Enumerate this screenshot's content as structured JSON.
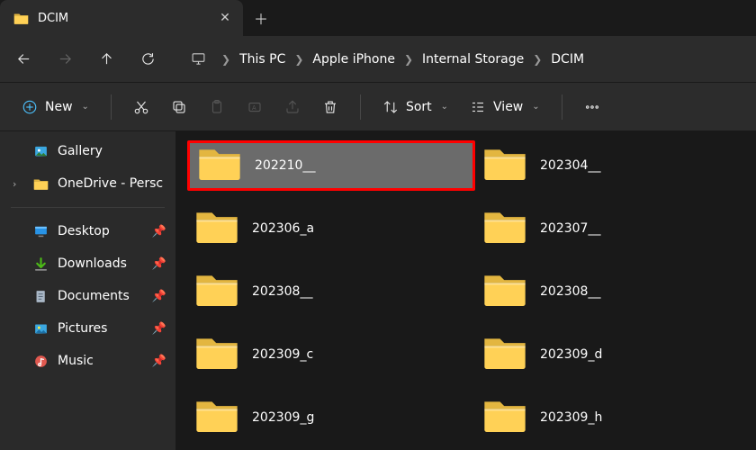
{
  "tab": {
    "title": "DCIM"
  },
  "breadcrumbs": {
    "items": [
      "This PC",
      "Apple iPhone",
      "Internal Storage",
      "DCIM"
    ]
  },
  "toolbar": {
    "new_label": "New",
    "sort_label": "Sort",
    "view_label": "View"
  },
  "sidebar": {
    "gallery": "Gallery",
    "onedrive": "OneDrive - Persc",
    "desktop": "Desktop",
    "downloads": "Downloads",
    "documents": "Documents",
    "pictures": "Pictures",
    "music": "Music"
  },
  "folders": [
    {
      "name": "202210__",
      "selected": true
    },
    {
      "name": "202304__"
    },
    {
      "name": "202306_a"
    },
    {
      "name": "202307__"
    },
    {
      "name": "202308__"
    },
    {
      "name": "202308__"
    },
    {
      "name": "202309_c"
    },
    {
      "name": "202309_d"
    },
    {
      "name": "202309_g"
    },
    {
      "name": "202309_h"
    }
  ]
}
